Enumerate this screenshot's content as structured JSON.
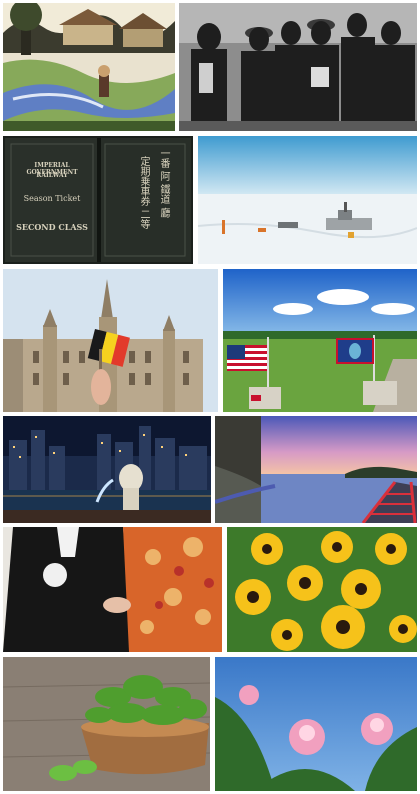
{
  "collage": {
    "tiles": [
      {
        "id": "woodblock-village",
        "subject": "woodblock print of a village stream with a figure"
      },
      {
        "id": "vintage-group-photo",
        "subject": "black and white group photo of men in hats"
      },
      {
        "id": "railway-season-ticket",
        "subject": "vintage railway season ticket cover",
        "text": {
          "line1": "IMPERIAL GOVERNMENT",
          "line2": "RAILWAY",
          "line3": "Season Ticket",
          "line4": "SECOND CLASS",
          "vertical_right": "一番 阿 鐵道 廳",
          "vertical_left": "定期乗車券 二等"
        }
      },
      {
        "id": "antarctic-station",
        "subject": "research station on snowy plain"
      },
      {
        "id": "gothic-town-hall",
        "subject": "gothic town hall with a hand holding a flag"
      },
      {
        "id": "flags-on-lawn",
        "subject": "two flags on stone pedestals on a lawn"
      },
      {
        "id": "city-night-skyline",
        "subject": "city skyline at night with lion fountain"
      },
      {
        "id": "pier-sunset",
        "subject": "red railed pier over water at sunset"
      },
      {
        "id": "kimono-ceremony",
        "subject": "person in black robe beside person in floral kimono"
      },
      {
        "id": "yellow-flowers",
        "subject": "yellow black-eyed susan flowers"
      },
      {
        "id": "mint-bowl",
        "subject": "fresh mint leaves in a wooden bowl"
      },
      {
        "id": "pink-blossoms",
        "subject": "pink silk tree blossoms against blue sky"
      }
    ]
  }
}
